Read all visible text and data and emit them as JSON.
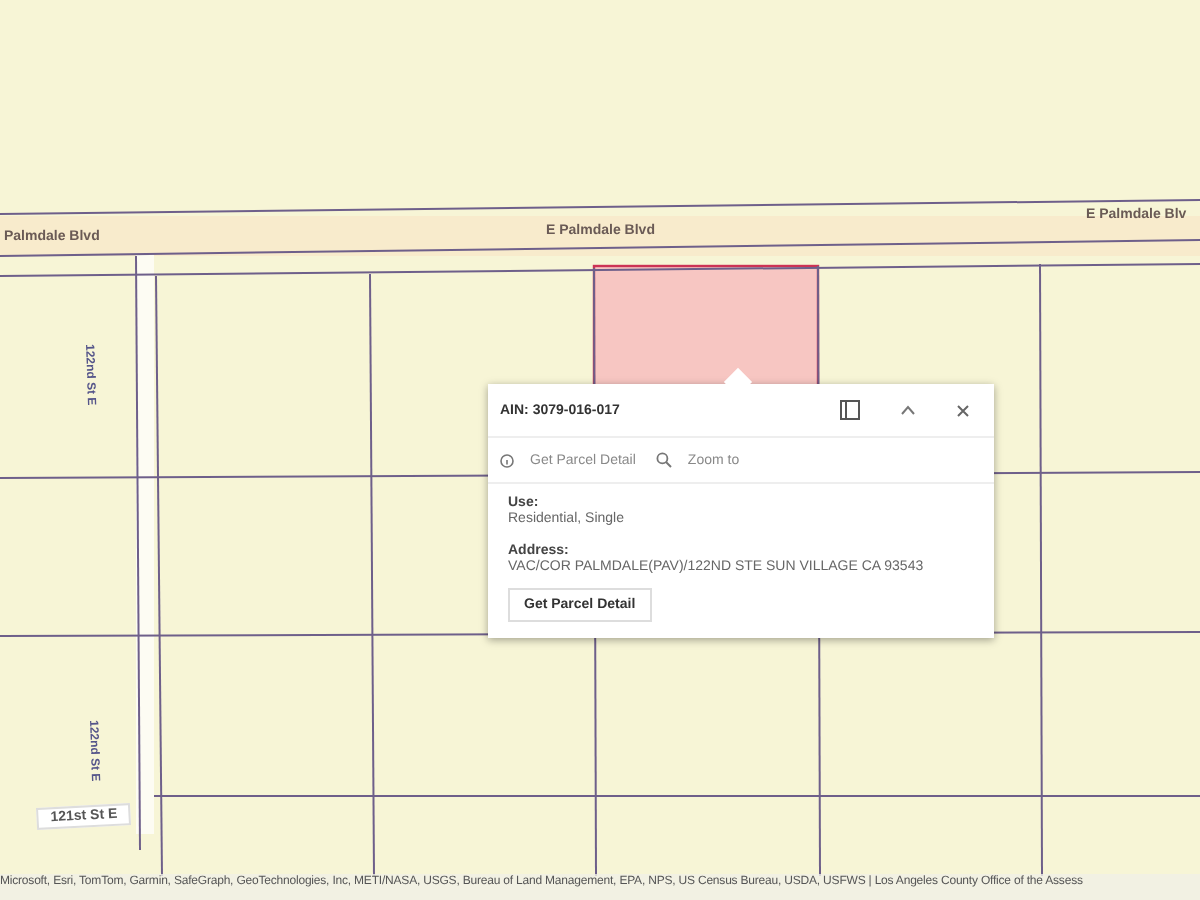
{
  "map": {
    "road_labels": [
      {
        "text": "Palmdale Blvd",
        "kind": "horizontal"
      },
      {
        "text": "E Palmdale Blvd",
        "kind": "horizontal"
      },
      {
        "text": "E Palmdale Blv",
        "kind": "horizontal"
      },
      {
        "text": "122nd St E",
        "kind": "vertical"
      },
      {
        "text": "122nd St E",
        "kind": "vertical"
      },
      {
        "text": "121st St E",
        "kind": "boxed"
      }
    ]
  },
  "popup": {
    "title": "AIN: 3079-016-017",
    "actions": [
      {
        "label": "Get Parcel Detail",
        "kind": "info"
      },
      {
        "label": "Zoom to",
        "kind": "zoom"
      }
    ],
    "fields": [
      {
        "label": "Use:",
        "value": "Residential, Single"
      },
      {
        "label": "Address:",
        "value": "VAC/COR PALMDALE(PAV)/122ND STE SUN VILLAGE CA 93543"
      }
    ],
    "button": "Get Parcel Detail"
  },
  "attribution": "Microsoft, Esri, TomTom, Garmin, SafeGraph, GeoTechnologies, Inc, METI/NASA, USGS, Bureau of Land Management, EPA, NPS, US Census Bureau, USDA, USFWS | Los Angeles County Office of the Assess"
}
